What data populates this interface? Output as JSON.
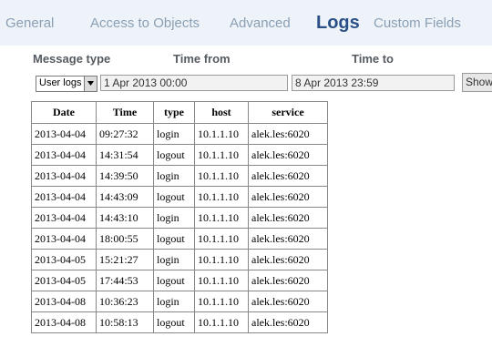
{
  "tabs": [
    {
      "label": "General",
      "active": false
    },
    {
      "label": "Access to Objects",
      "active": false
    },
    {
      "label": "Advanced",
      "active": false
    },
    {
      "label": "Logs",
      "active": true
    },
    {
      "label": "Custom Fields",
      "active": false
    }
  ],
  "filters": {
    "message_type_label": "Message type",
    "time_from_label": "Time from",
    "time_to_label": "Time to",
    "message_type_value": "User logs",
    "time_from_value": "1 Apr 2013 00:00",
    "time_to_value": "8 Apr 2013 23:59",
    "show_button": "Show"
  },
  "table": {
    "headers": [
      "Date",
      "Time",
      "type",
      "host",
      "service"
    ],
    "rows": [
      [
        "2013-04-04",
        "09:27:32",
        "login",
        "10.1.1.10",
        "alek.les:6020"
      ],
      [
        "2013-04-04",
        "14:31:54",
        "logout",
        "10.1.1.10",
        "alek.les:6020"
      ],
      [
        "2013-04-04",
        "14:39:50",
        "login",
        "10.1.1.10",
        "alek.les:6020"
      ],
      [
        "2013-04-04",
        "14:43:09",
        "logout",
        "10.1.1.10",
        "alek.les:6020"
      ],
      [
        "2013-04-04",
        "14:43:10",
        "login",
        "10.1.1.10",
        "alek.les:6020"
      ],
      [
        "2013-04-04",
        "18:00:55",
        "logout",
        "10.1.1.10",
        "alek.les:6020"
      ],
      [
        "2013-04-05",
        "15:21:27",
        "login",
        "10.1.1.10",
        "alek.les:6020"
      ],
      [
        "2013-04-05",
        "17:44:53",
        "logout",
        "10.1.1.10",
        "alek.les:6020"
      ],
      [
        "2013-04-08",
        "10:36:23",
        "login",
        "10.1.1.10",
        "alek.les:6020"
      ],
      [
        "2013-04-08",
        "10:58:13",
        "logout",
        "10.1.1.10",
        "alek.les:6020"
      ]
    ]
  },
  "colors": {
    "tab_inactive": "#8a9fb4",
    "tab_active": "#2a4f86",
    "header_band": "#eef3f9"
  }
}
